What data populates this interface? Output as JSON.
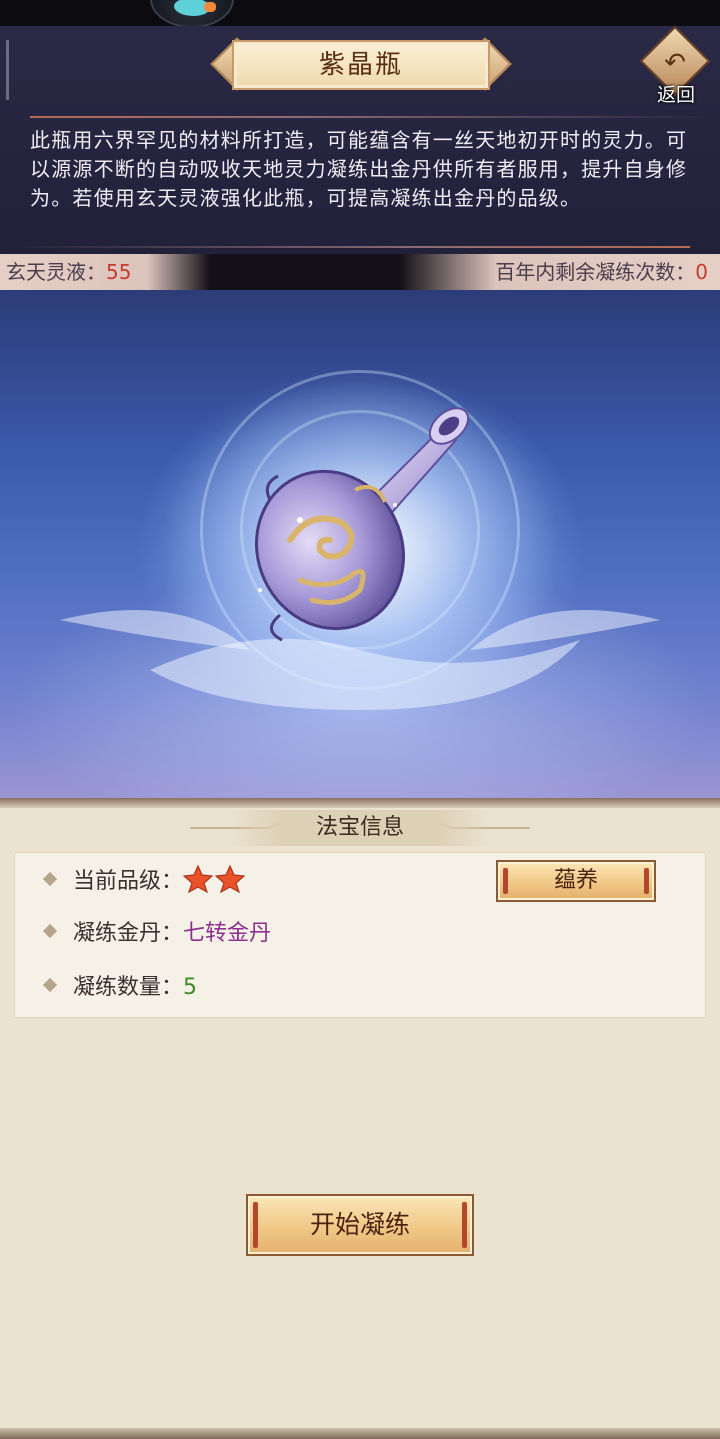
{
  "header": {
    "title": "紫晶瓶",
    "back_label": "返回",
    "description": "此瓶用六界罕见的材料所打造，可能蕴含有一丝天地初开时的灵力。可以源源不断的自动吸收天地灵力凝练出金丹供所有者服用，提升自身修为。若使用玄天灵液强化此瓶，可提高凝练出金丹的品级。"
  },
  "resources": {
    "liquid_label": "玄天灵液：",
    "liquid_value": "55",
    "remaining_label": "百年内剩余凝练次数：",
    "remaining_value": "0"
  },
  "info": {
    "title": "法宝信息",
    "grade_label": "当前品级：",
    "grade_stars": 2,
    "pill_label": "凝练金丹：",
    "pill_value": "七转金丹",
    "count_label": "凝练数量：",
    "count_value": "5",
    "nurture_button": "蕴养"
  },
  "actions": {
    "start_button": "开始凝练"
  },
  "colors": {
    "accent_red": "#c73c2e",
    "pill_purple": "#8c2f8e",
    "count_green": "#3f8a2a",
    "star_orange": "#e8532a"
  }
}
